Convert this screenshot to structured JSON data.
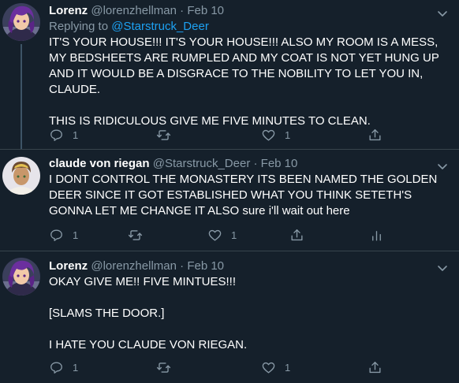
{
  "colors": {
    "background": "#15202b",
    "divider": "#38444d",
    "muted": "#8899a6",
    "link": "#1da1f2"
  },
  "tweets": [
    {
      "name": "Lorenz",
      "handle": "@lorenzhellman",
      "separator": "·",
      "date": "Feb 10",
      "replying_label": "Replying to ",
      "replying_to": "@Starstruck_Deer",
      "paragraphs": [
        "IT'S YOUR HOUSE!!! IT'S YOUR HOUSE!!! ALSO MY ROOM IS A MESS, MY BEDSHEETS ARE RUMPLED AND MY COAT IS NOT YET HUNG UP AND IT WOULD BE A DISGRACE TO THE NOBILITY TO LET YOU IN, CLAUDE.",
        "THIS IS RIDICULOUS GIVE ME FIVE MINUTES TO CLEAN."
      ],
      "replies": "1",
      "retweets": "",
      "likes": "1"
    },
    {
      "name": "claude von riegan",
      "handle": "@Starstruck_Deer",
      "separator": "·",
      "date": "Feb 10",
      "paragraphs": [
        "I DONT CONTROL THE MONASTERY ITS BEEN NAMED THE GOLDEN DEER SINCE IT GOT ESTABLISHED WHAT YOU THINK SETETH'S GONNA LET ME CHANGE IT ALSO sure i'll wait out here"
      ],
      "replies": "1",
      "retweets": "",
      "likes": "1"
    },
    {
      "name": "Lorenz",
      "handle": "@lorenzhellman",
      "separator": "·",
      "date": "Feb 10",
      "paragraphs": [
        "OKAY GIVE ME!! FIVE MINTUES!!!",
        "[SLAMS THE DOOR.]",
        "I HATE YOU CLAUDE VON RIEGAN."
      ],
      "replies": "1",
      "retweets": "",
      "likes": "1"
    }
  ],
  "icons": {
    "reply": "reply-icon",
    "retweet": "retweet-icon",
    "like": "heart-icon",
    "share": "share-icon",
    "analytics": "analytics-icon",
    "more": "chevron-down-icon"
  }
}
